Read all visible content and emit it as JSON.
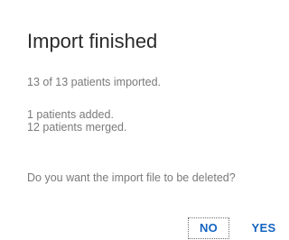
{
  "dialog": {
    "title": "Import finished",
    "imported_summary": "13 of 13 patients imported.",
    "added_summary": "1 patients added.",
    "merged_summary": "12 patients merged.",
    "question": "Do you want the import file to be deleted?",
    "buttons": {
      "no_label": "NO",
      "yes_label": "YES"
    }
  },
  "colors": {
    "title": "#2b2b2b",
    "body_text": "#7a7a7a",
    "accent": "#1565c0",
    "background": "#ffffff"
  }
}
